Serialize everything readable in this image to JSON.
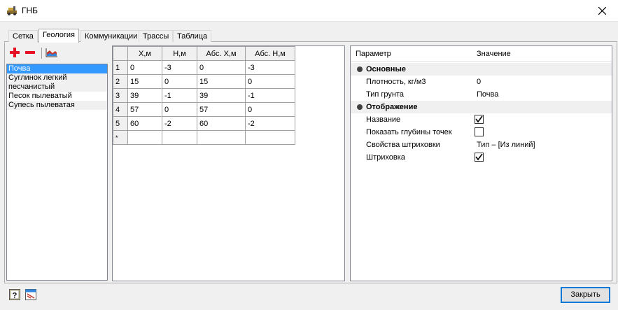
{
  "window": {
    "title": "ГНБ"
  },
  "tabs": [
    "Сетка",
    "Геология",
    "Коммуникации",
    "Трассы",
    "Таблица"
  ],
  "active_tab": "Геология",
  "layers": [
    "Почва",
    "Суглинок легкий\nпесчанистый",
    "Песок пылеватый",
    "Супесь пылеватая"
  ],
  "grid": {
    "columns": [
      "X,м",
      "H,м",
      "Абс. X,м",
      "Абс. H,м"
    ],
    "rows": [
      {
        "n": "1",
        "cells": [
          "0",
          "-3",
          "0",
          "-3"
        ]
      },
      {
        "n": "2",
        "cells": [
          "15",
          "0",
          "15",
          "0"
        ]
      },
      {
        "n": "3",
        "cells": [
          "39",
          "-1",
          "39",
          "-1"
        ]
      },
      {
        "n": "4",
        "cells": [
          "57",
          "0",
          "57",
          "0"
        ]
      },
      {
        "n": "5",
        "cells": [
          "60",
          "-2",
          "60",
          "-2"
        ]
      }
    ],
    "new_row_marker": "*"
  },
  "properties": {
    "header_param": "Параметр",
    "header_value": "Значение",
    "cat_basic": "Основные",
    "density_label": "Плотность, кг/м3",
    "density_value": "0",
    "soil_type_label": "Тип грунта",
    "soil_type_value": "Почва",
    "cat_display": "Отображение",
    "name_label": "Название",
    "name_checked": true,
    "show_depth_label": "Показать глубины точек",
    "show_depth_checked": false,
    "hatch_props_label": "Свойства штриховки",
    "hatch_props_value": "Тип – [Из линий]",
    "hatch_label": "Штриховка",
    "hatch_checked": true
  },
  "buttons": {
    "close": "Закрыть"
  },
  "icons": [
    "app-icon",
    "close-icon",
    "add-icon",
    "remove-icon",
    "profile-icon",
    "help-icon",
    "settings-icon",
    "category-bullet-icon",
    "checkmark-icon"
  ],
  "colors": {
    "selection": "#3399ff",
    "add": "#e81123",
    "accent": "#0078d7"
  }
}
